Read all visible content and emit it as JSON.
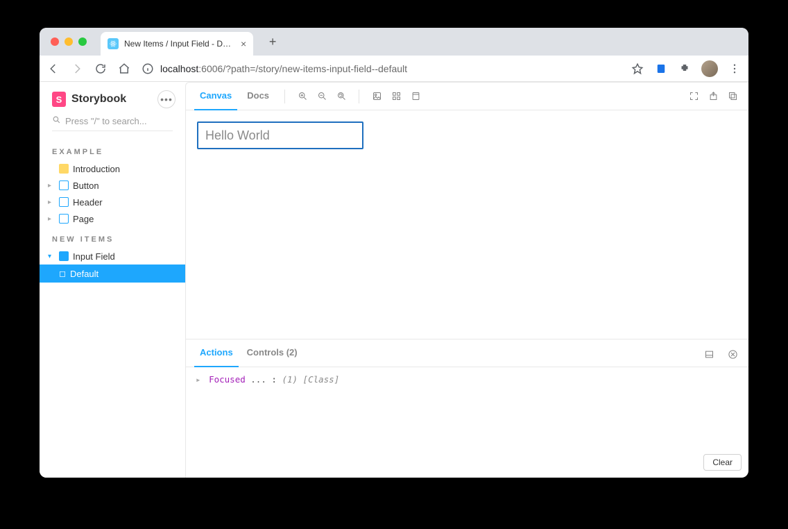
{
  "browser": {
    "tab_title": "New Items / Input Field - Defau",
    "url_host": "localhost",
    "url_port": ":6006",
    "url_path": "/?path=/story/new-items-input-field--default"
  },
  "brand": {
    "name": "Storybook",
    "logo_letter": "S"
  },
  "search": {
    "placeholder": "Press \"/\" to search..."
  },
  "groups": [
    {
      "title": "EXAMPLE",
      "items": [
        {
          "label": "Introduction",
          "kind": "doc"
        },
        {
          "label": "Button",
          "kind": "component"
        },
        {
          "label": "Header",
          "kind": "component"
        },
        {
          "label": "Page",
          "kind": "component"
        }
      ]
    },
    {
      "title": "NEW ITEMS",
      "items": [
        {
          "label": "Input Field",
          "kind": "component",
          "open": true,
          "children": [
            {
              "label": "Default",
              "selected": true
            }
          ]
        }
      ]
    }
  ],
  "toolbar": {
    "tabs": {
      "canvas": "Canvas",
      "docs": "Docs"
    }
  },
  "canvas": {
    "input_placeholder": "Hello World",
    "input_value": ""
  },
  "addons": {
    "tabs": {
      "actions": "Actions",
      "controls": "Controls (2)"
    },
    "log": {
      "event": "Focused",
      "dots": "...",
      "colon": ":",
      "meta": "(1) [Class]"
    },
    "clear": "Clear"
  }
}
